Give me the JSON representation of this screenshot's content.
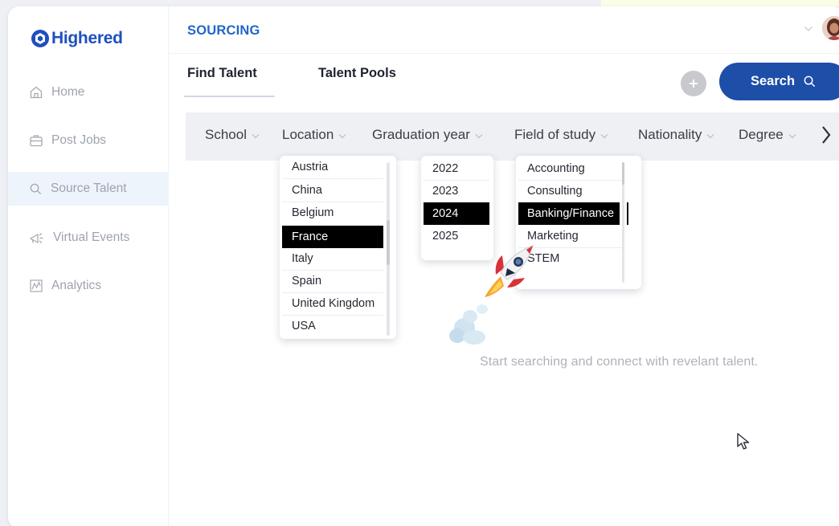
{
  "brand": {
    "name": "Highered",
    "color": "#1f4fbf"
  },
  "sidebar": {
    "items": [
      {
        "label": "Home",
        "icon": "home-icon",
        "active": false
      },
      {
        "label": "Post Jobs",
        "icon": "briefcase-icon",
        "active": false
      },
      {
        "label": "Source Talent",
        "icon": "search-icon",
        "active": true
      },
      {
        "label": "Virtual Events",
        "icon": "megaphone-icon",
        "active": false
      },
      {
        "label": "Analytics",
        "icon": "analytics-icon",
        "active": false
      }
    ]
  },
  "header": {
    "section_title": "SOURCING",
    "avatar_icon": "user-avatar"
  },
  "tabs": [
    {
      "label": "Find Talent",
      "active": true
    },
    {
      "label": "Talent Pools",
      "active": false
    }
  ],
  "actions": {
    "add_icon": "plus-icon",
    "search_label": "Search",
    "search_icon": "search-icon",
    "accent": "#1d4ea8"
  },
  "filters": [
    "School",
    "Location",
    "Graduation year",
    "Field of study",
    "Nationality",
    "Degree"
  ],
  "dropdowns": {
    "location": {
      "options": [
        "Austria",
        "China",
        "Belgium",
        "France",
        "Italy",
        "Spain",
        "United Kingdom",
        "USA"
      ],
      "selected": "France"
    },
    "graduation_year": {
      "options": [
        "2022",
        "2023",
        "2024",
        "2025"
      ],
      "selected": "2024"
    },
    "field_of_study": {
      "options": [
        "Accounting",
        "Consulting",
        "Banking/Finance",
        "Marketing",
        "STEM"
      ],
      "selected": "Banking/Finance"
    }
  },
  "empty_state": {
    "message": "Start searching and connect with revelant talent.",
    "illustration": "rocket-illustration"
  },
  "colors": {
    "section_title": "#2166c6",
    "nav_active_bg": "#eef4fb",
    "selected_bg": "#000000"
  }
}
